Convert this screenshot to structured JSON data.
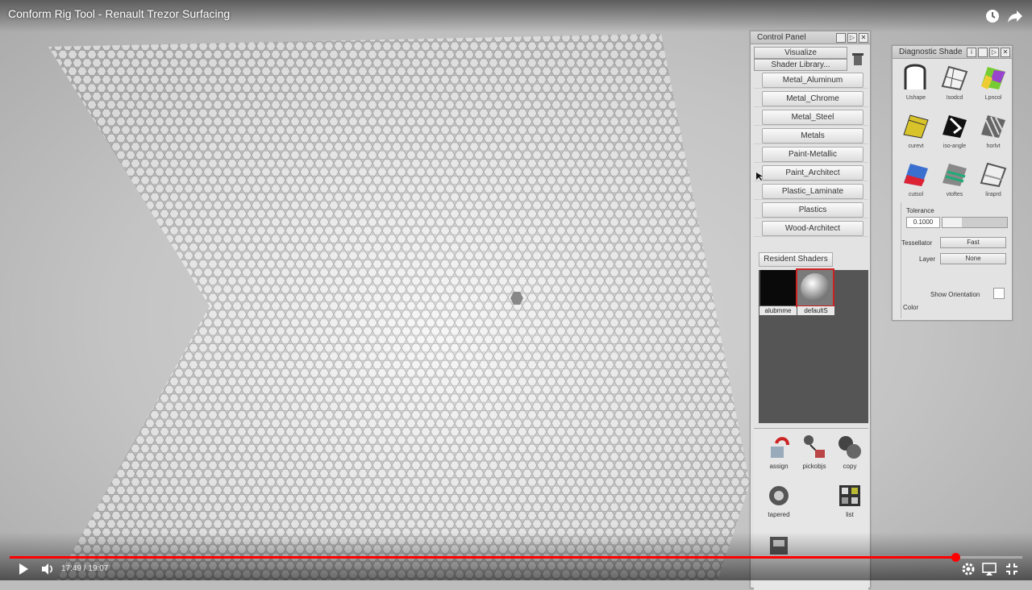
{
  "video": {
    "title": "Conform Rig Tool - Renault Trezor Surfacing",
    "current_time": "17:49",
    "duration": "19:07",
    "time_display": "17:49 / 19:07",
    "progress_fraction": 0.934,
    "accent_color": "#ff0000"
  },
  "top_icons": [
    "clock-icon",
    "share-icon"
  ],
  "control_panel": {
    "title": "Control Panel",
    "visualize_label": "Visualize",
    "shader_library_label": "Shader Library...",
    "shader_libraries": [
      "Metal_Aluminum",
      "Metal_Chrome",
      "Metal_Steel",
      "Metals",
      "Paint-Metallic",
      "Paint_Architect",
      "Plastic_Laminate",
      "Plastics",
      "Wood-Architect"
    ],
    "resident_shaders_label": "Resident Shaders",
    "resident_shaders": [
      {
        "label": "alubmme",
        "color": "#0a0a0a"
      },
      {
        "label": "defaultS",
        "color": "#bdbdbd"
      }
    ],
    "tools": [
      "assign",
      "pickobjs",
      "copy",
      "tapered",
      "",
      "list"
    ]
  },
  "diagnostic_panel": {
    "title": "Diagnostic Shade",
    "shades": [
      "Ushape",
      "Isodcd",
      "Lpncol",
      "curevt",
      "iso-angle",
      "horlvt",
      "cutsol",
      "vtoftes",
      "liraprd"
    ],
    "tolerance_label": "Tolerance",
    "tolerance_value": "0.1000",
    "tessellator_label": "Tessellator",
    "tessellator_value": "Fast",
    "layer_label": "Layer",
    "layer_value": "None",
    "show_orientation_label": "Show Orientation",
    "color_label": "Color"
  }
}
